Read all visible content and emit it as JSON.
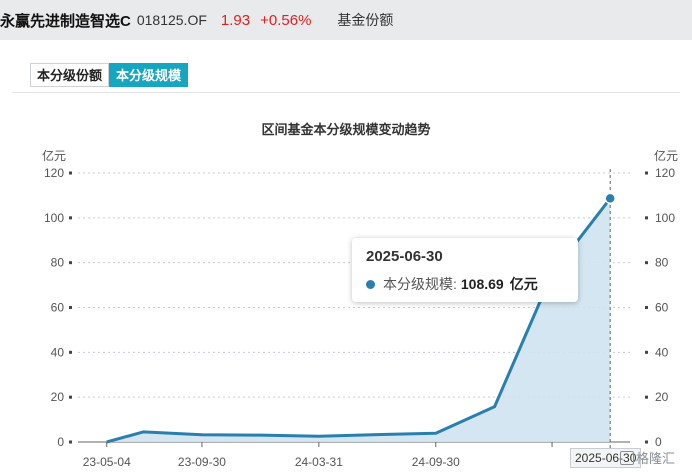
{
  "header": {
    "fund_name": "永赢先进制造智选C",
    "fund_code": "018125.OF",
    "nav": "1.93",
    "change": "+0.56%",
    "section": "基金份额"
  },
  "tabs": [
    {
      "label": "本分级份额",
      "active": false
    },
    {
      "label": "本分级规模",
      "active": true
    }
  ],
  "colors": {
    "accent": "#17a6bf",
    "line": "#2a7fae",
    "area": "#cfe3ef",
    "up": "#e02020"
  },
  "tooltip": {
    "date": "2025-06-30",
    "series_label": "本分级规模:",
    "value": "108.69",
    "unit": "亿元"
  },
  "cursor_label": "2025-06-30",
  "watermark": "格隆汇",
  "chart_data": {
    "type": "area",
    "title": "区间基金本分级规模变动趋势",
    "ylabel_left": "亿元",
    "ylabel_right": "亿元",
    "ylim": [
      0,
      120
    ],
    "yticks": [
      0,
      20,
      40,
      60,
      80,
      100,
      120
    ],
    "xtick_labels": [
      "23-05-04",
      "23-09-30",
      "24-03-31",
      "24-09-30"
    ],
    "grid": true,
    "series": [
      {
        "name": "本分级规模",
        "x": [
          "2023-05-04",
          "2023-06-30",
          "2023-09-30",
          "2023-12-31",
          "2024-03-31",
          "2024-06-30",
          "2024-09-30",
          "2024-12-31",
          "2025-03-31",
          "2025-06-30"
        ],
        "values": [
          0.0,
          4.5,
          3.2,
          3.1,
          2.6,
          3.3,
          3.9,
          15.8,
          75.0,
          108.69
        ]
      }
    ]
  }
}
